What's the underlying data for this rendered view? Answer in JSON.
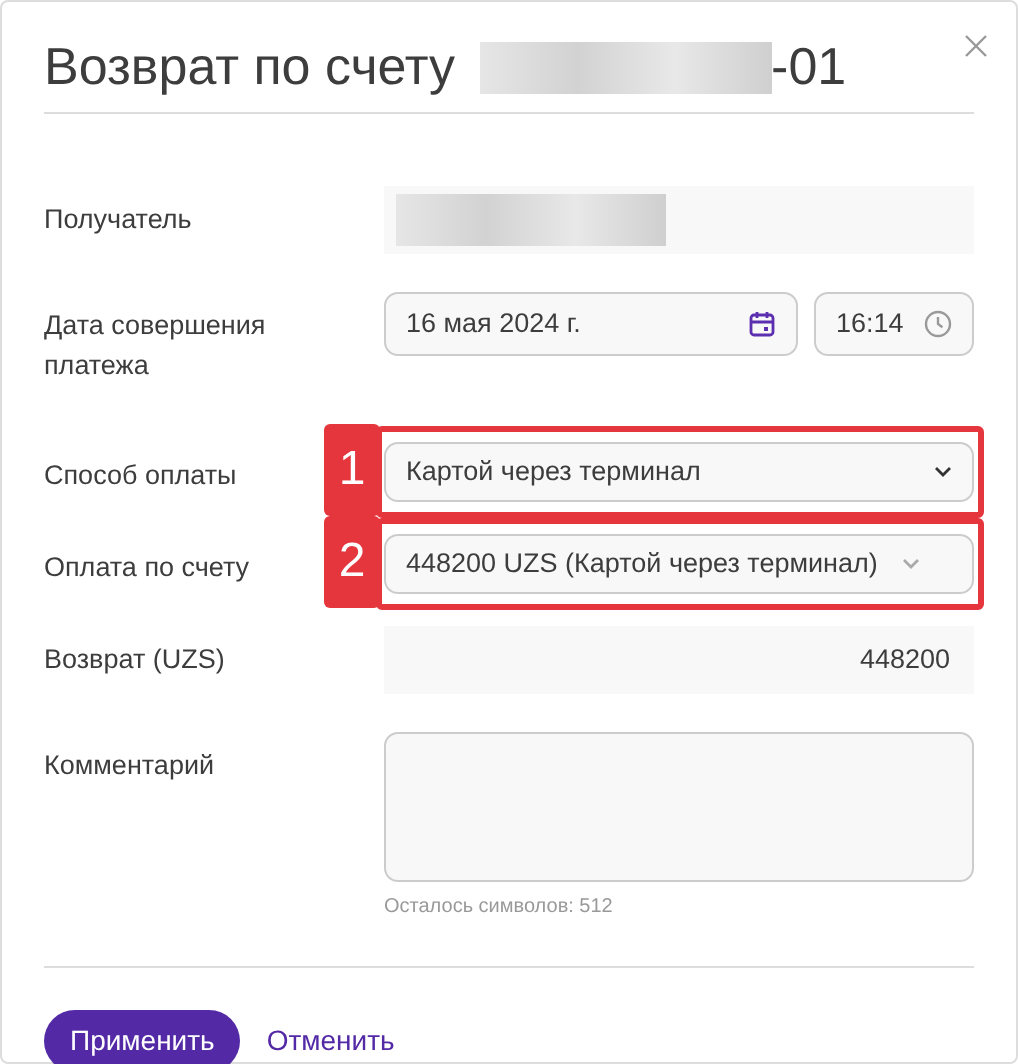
{
  "dialog": {
    "title": "Возврат по счету",
    "title_suffix": "-01",
    "title_redacted": true
  },
  "fields": [
    {
      "kind": "readonly",
      "label": "Получатель",
      "value_redacted": true
    },
    {
      "kind": "datetime",
      "label": "Дата совершения платежа",
      "date": "16 мая 2024 г.",
      "time": "16:14"
    },
    {
      "kind": "select",
      "label": "Способ оплаты",
      "value": "Картой через терминал",
      "callout": "1"
    },
    {
      "kind": "select-light",
      "label": "Оплата по счету",
      "value": "448200 UZS (Картой через терминал)",
      "callout": "2"
    },
    {
      "kind": "readonly",
      "label": "Возврат (UZS)",
      "value": "448200"
    },
    {
      "kind": "textarea",
      "label": "Комментарий",
      "hint": "Осталось символов: 512"
    }
  ],
  "buttons": [
    {
      "kind": "primary",
      "label": "Применить"
    },
    {
      "kind": "link",
      "label": "Отменить"
    }
  ]
}
